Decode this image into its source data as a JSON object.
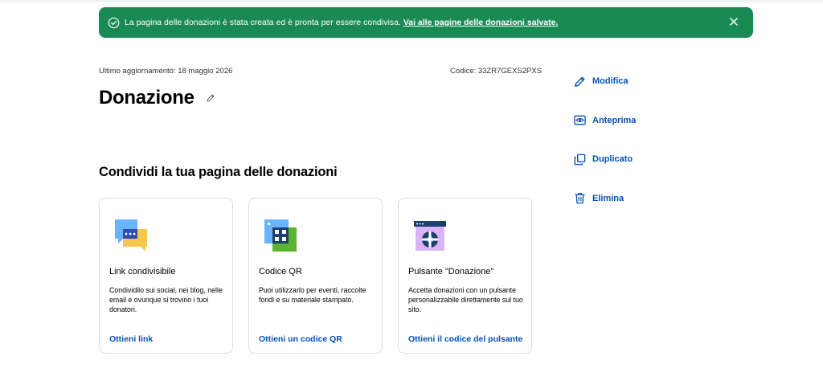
{
  "banner": {
    "message": "La pagina delle donazioni è stata creata ed è pronta per essere condivisa.",
    "link": "Vai alle pagine delle donazioni salvate.",
    "color": "#1a8a55"
  },
  "meta": {
    "last_updated": "Ultimo aggiornamento: 18 maggio 2026",
    "code": "Codice: 33ZR7GEXS2PXS"
  },
  "page": {
    "title": "Donazione"
  },
  "actions": [
    {
      "label": "Modifica",
      "icon": "pencil-icon"
    },
    {
      "label": "Anteprima",
      "icon": "eye-icon"
    },
    {
      "label": "Duplicato",
      "icon": "duplicate-icon"
    },
    {
      "label": "Elimina",
      "icon": "trash-icon"
    }
  ],
  "share": {
    "title": "Condividi la tua pagina delle donazioni",
    "cards": [
      {
        "icon": "chat-bubbles-icon",
        "title": "Link condivisibile",
        "description": "Condividilo sui social, nei blog, nelle email e ovunque si trovino i tuoi donatori.",
        "link": "Ottieni link"
      },
      {
        "icon": "qr-code-icon",
        "title": "Codice QR",
        "description": "Puoi utilizzarlo per eventi, raccolte fondi e su materiale stampato.",
        "link": "Ottieni un codice QR"
      },
      {
        "icon": "donate-button-icon",
        "title": "Pulsante \"Donazione\"",
        "description": "Accetta donazioni con un pulsante personalizzabile direttamente sul tuo sito.",
        "link": "Ottieni il codice del pulsante"
      }
    ]
  },
  "colors": {
    "accent_link": "#0551b5",
    "heading": "#000000"
  }
}
